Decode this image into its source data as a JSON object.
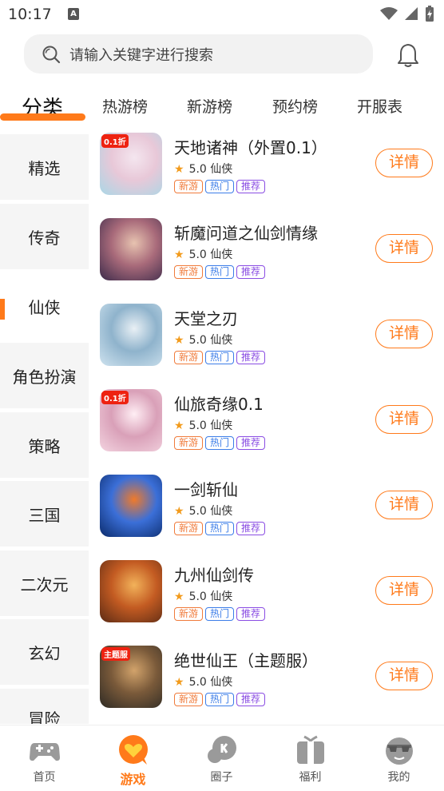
{
  "status": {
    "time": "10:17",
    "app_icon": "A"
  },
  "search": {
    "placeholder": "请输入关键字进行搜索"
  },
  "tabs": [
    "分类",
    "热游榜",
    "新游榜",
    "预约榜",
    "开服表"
  ],
  "categories": [
    "精选",
    "传奇",
    "仙侠",
    "角色扮演",
    "策略",
    "三国",
    "二次元",
    "玄幻",
    "冒险"
  ],
  "active_category_index": 2,
  "games": [
    {
      "name": "天地诸神（外置0.1）",
      "rating": "5.0",
      "genre": "仙侠",
      "badge": "0.1折",
      "tags": [
        "新游",
        "热门",
        "推荐"
      ],
      "detail": "详情"
    },
    {
      "name": "斩魔问道之仙剑情缘",
      "rating": "5.0",
      "genre": "仙侠",
      "badge": "",
      "tags": [
        "新游",
        "热门",
        "推荐"
      ],
      "detail": "详情"
    },
    {
      "name": "天堂之刃",
      "rating": "5.0",
      "genre": "仙侠",
      "badge": "",
      "tags": [
        "新游",
        "热门",
        "推荐"
      ],
      "detail": "详情"
    },
    {
      "name": "仙旅奇缘0.1",
      "rating": "5.0",
      "genre": "仙侠",
      "badge": "0.1折",
      "tags": [
        "新游",
        "热门",
        "推荐"
      ],
      "detail": "详情"
    },
    {
      "name": "一剑斩仙",
      "rating": "5.0",
      "genre": "仙侠",
      "badge": "",
      "tags": [
        "新游",
        "热门",
        "推荐"
      ],
      "detail": "详情"
    },
    {
      "name": "九州仙剑传",
      "rating": "5.0",
      "genre": "仙侠",
      "badge": "",
      "tags": [
        "新游",
        "热门",
        "推荐"
      ],
      "detail": "详情"
    },
    {
      "name": "绝世仙王（主题服）",
      "rating": "5.0",
      "genre": "仙侠",
      "badge": "主题服",
      "tags": [
        "新游",
        "热门",
        "推荐"
      ],
      "detail": "详情"
    }
  ],
  "bottom_nav": [
    {
      "label": "首页",
      "icon": "gamepad-icon"
    },
    {
      "label": "游戏",
      "icon": "heart-chat-icon"
    },
    {
      "label": "圈子",
      "icon": "bubble-icon"
    },
    {
      "label": "福利",
      "icon": "gift-icon"
    },
    {
      "label": "我的",
      "icon": "profile-icon"
    }
  ],
  "colors": {
    "accent": "#ff7a1a",
    "tag_new": "#f07b3b",
    "tag_hot": "#3c7de8",
    "tag_rec": "#8a4de3",
    "star": "#f29b1c"
  }
}
